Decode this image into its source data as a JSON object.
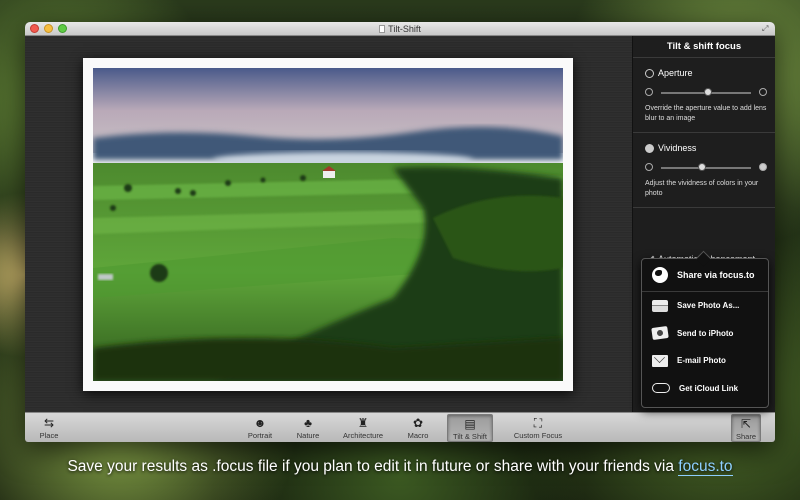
{
  "window": {
    "title": "Tilt-Shift"
  },
  "sidebar": {
    "header": "Tilt & shift focus",
    "aperture": {
      "title": "Aperture",
      "value": 0.52,
      "description": "Override the aperture value to add lens blur to an image"
    },
    "vividness": {
      "title": "Vividness",
      "value": 0.45,
      "description": "Adjust the vividness of colors in your photo"
    },
    "auto_enhancement": "Automatic enhancement"
  },
  "share_menu": {
    "top": "Share via focus.to",
    "items": [
      {
        "label": "Save Photo As...",
        "icon": "drive-icon"
      },
      {
        "label": "Send to iPhoto",
        "icon": "iphoto-icon"
      },
      {
        "label": "E-mail Photo",
        "icon": "mail-icon"
      },
      {
        "label": "Get iCloud Link",
        "icon": "cloud-icon"
      }
    ]
  },
  "toolbar": {
    "place": "Place",
    "portrait": "Portrait",
    "nature": "Nature",
    "architecture": "Architecture",
    "macro": "Macro",
    "tilt_shift": "Tilt & Shift",
    "custom_focus": "Custom Focus",
    "share": "Share",
    "active": "tilt_shift"
  },
  "caption": {
    "text": "Save your results as .focus file if you plan to edit it in future or share with your friends via ",
    "link": "focus.to"
  }
}
